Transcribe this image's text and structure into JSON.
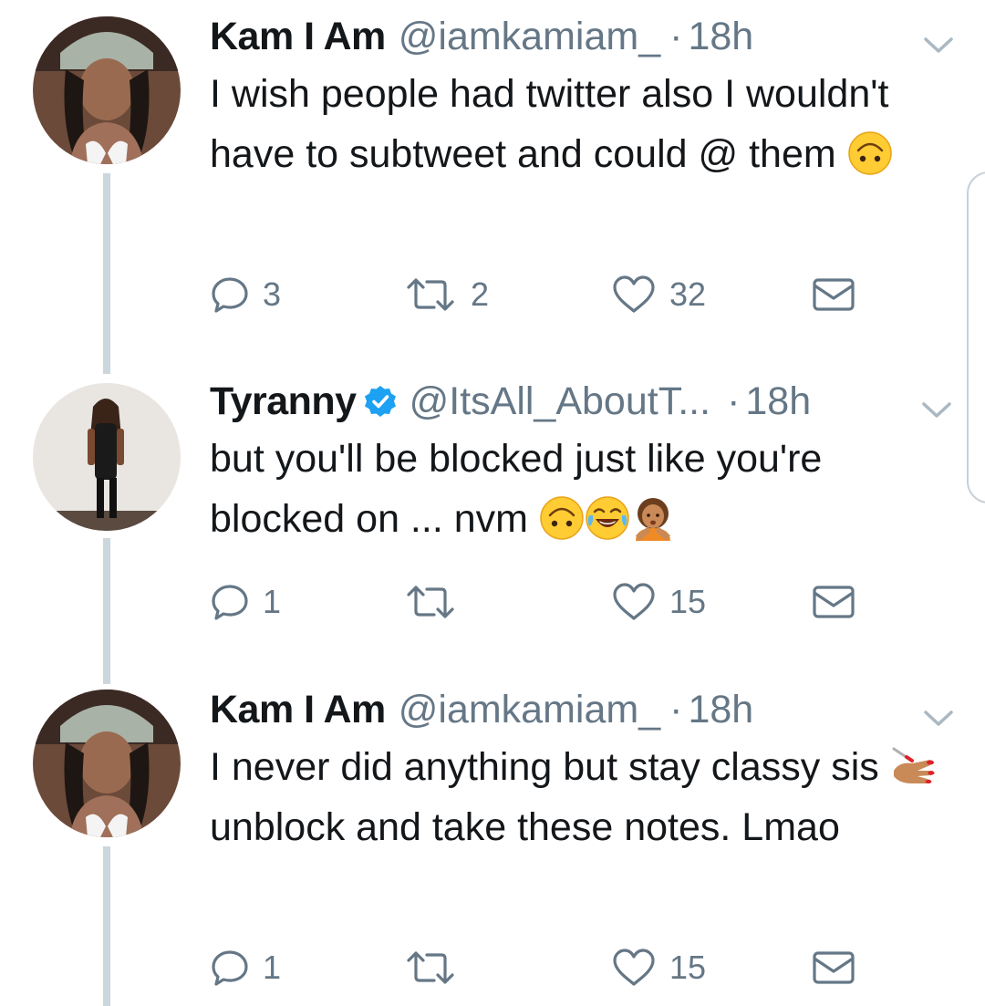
{
  "tweets": [
    {
      "name": "Kam I Am",
      "handle": "@iamkamiam_",
      "time": "18h",
      "verified": false,
      "text_parts": [
        "I wish people had twitter also I wouldn't have to subtweet and could @ them "
      ],
      "replies": "3",
      "retweets": "2",
      "likes": "32",
      "emojis": [
        "upside-down-face"
      ]
    },
    {
      "name": "Tyranny",
      "handle": "@ItsAll_AboutT...",
      "time": "18h",
      "verified": true,
      "text_parts": [
        "but you'll be blocked just like you're blocked on ... nvm "
      ],
      "replies": "1",
      "retweets": "",
      "likes": "15",
      "emojis": [
        "upside-down-face",
        "tears-of-joy-face",
        "person-gesturing-no"
      ]
    },
    {
      "name": "Kam I Am",
      "handle": "@iamkamiam_",
      "time": "18h",
      "verified": false,
      "text_parts": [
        "I never did anything but stay classy sis ",
        " unblock and take these notes. Lmao"
      ],
      "replies": "1",
      "retweets": "",
      "likes": "15",
      "emojis": [
        "nail-polish"
      ]
    }
  ],
  "colors": {
    "text": "#14171a",
    "secondary": "#657786",
    "verified": "#1da1f2",
    "thread_line": "#ccd6dd"
  }
}
